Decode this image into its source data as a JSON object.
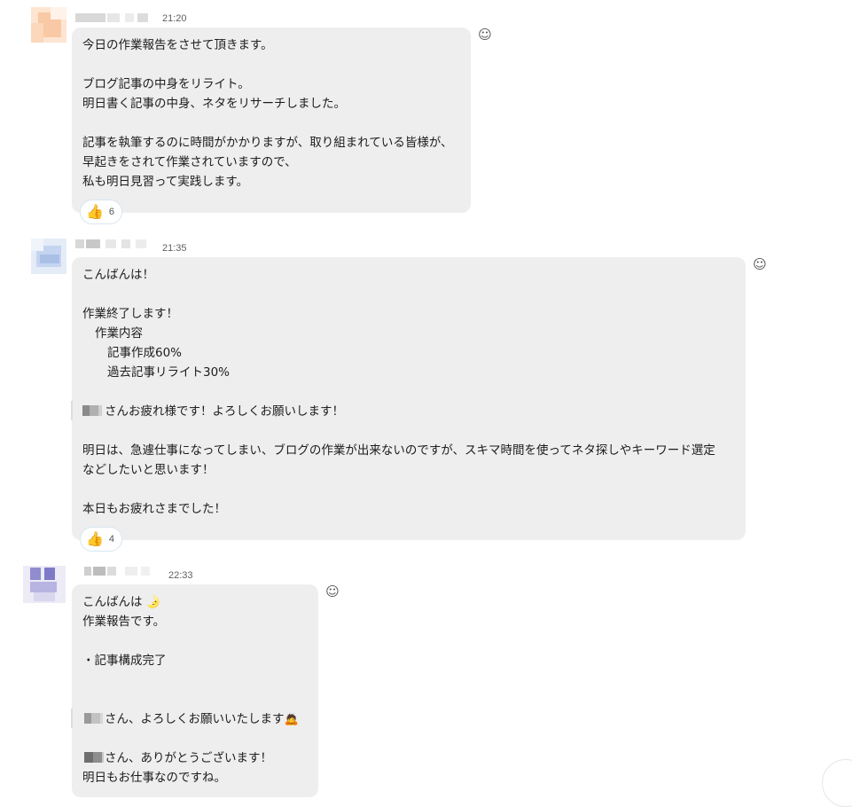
{
  "messages": [
    {
      "time": "21:20",
      "lines": [
        "今日の作業報告をさせて頂きます。",
        "",
        "ブログ記事の中身をリライト。",
        "明日書く記事の中身、ネタをリサーチしました。",
        "",
        "記事を執筆するのに時間がかかりますが、取り組まれている皆様が、",
        "早起きをされて作業されていますので、",
        "私も明日見習って実践します。"
      ],
      "reaction": {
        "icon": "thumbs-up-icon",
        "emoji": "👍",
        "count": "6"
      },
      "smiley_icon": "smiley-face-icon"
    },
    {
      "time": "21:35",
      "lines": [
        "こんばんは！",
        "",
        "作業終了します！",
        "作業内容",
        "記事作成60%",
        "過去記事リライト30%",
        "",
        "さんお疲れ様です！よろしくお願いします！",
        "",
        "明日は、急遽仕事になってしまい、ブログの作業が出来ないのですが、スキマ時間を使ってネタ探しやキーワード選定",
        "などしたいと思います！",
        "",
        "本日もお疲れさまでした！"
      ],
      "reaction": {
        "icon": "thumbs-up-icon",
        "emoji": "👍",
        "count": "4"
      },
      "smiley_icon": "smiley-face-icon"
    },
    {
      "time": "22:33",
      "lines": [
        "こんばんは",
        "作業報告です。",
        "",
        "・記事構成完了",
        "",
        "",
        "さん、よろしくお願いいたします",
        "",
        "さん、ありがとうございます！",
        "明日もお仕事なのですね。"
      ],
      "inline_emoji": {
        "moon": "🌛",
        "bow": "🙇"
      },
      "smiley_icon": "smiley-face-icon"
    }
  ]
}
